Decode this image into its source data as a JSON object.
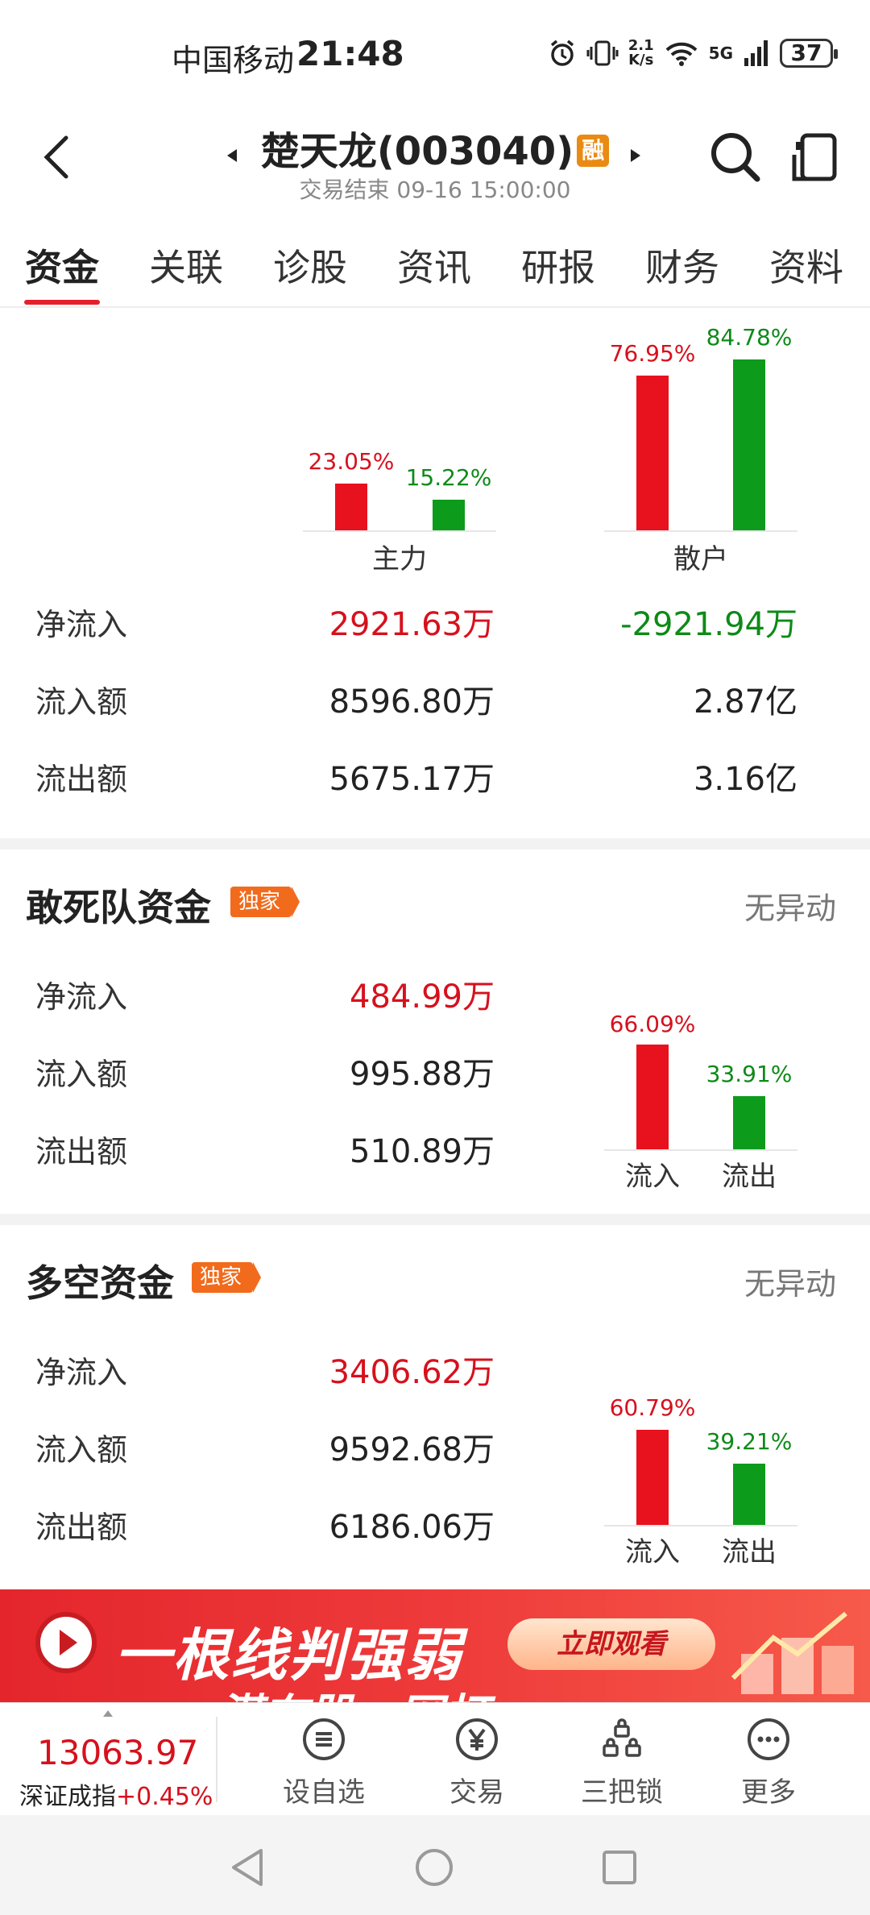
{
  "status_bar": {
    "carrier": "中国移动",
    "time": "21:48",
    "net_speed_value": "2.1",
    "net_speed_unit": "K/s",
    "network": "5G",
    "battery": "37"
  },
  "header": {
    "stock_name": "楚天龙(003040)",
    "margin_badge": "融",
    "trade_status": "交易结束 09-16 15:00:00"
  },
  "tabs": [
    "资金",
    "关联",
    "诊股",
    "资讯",
    "研报",
    "财务",
    "资料"
  ],
  "main_funds": {
    "chart_data": {
      "type": "bar",
      "categories": [
        "主力",
        "散户"
      ],
      "series": [
        {
          "name": "流入",
          "values": [
            23.05,
            76.95
          ],
          "labels": [
            "23.05%",
            "76.95%"
          ]
        },
        {
          "name": "流出",
          "values": [
            15.22,
            84.78
          ],
          "labels": [
            "15.22%",
            "84.78%"
          ]
        }
      ]
    },
    "rows": [
      {
        "label": "净流入",
        "main": "2921.63万",
        "retail": "-2921.94万"
      },
      {
        "label": "流入额",
        "main": "8596.80万",
        "retail": "2.87亿"
      },
      {
        "label": "流出额",
        "main": "5675.17万",
        "retail": "3.16亿"
      }
    ]
  },
  "dare_to_die": {
    "title": "敢死队资金",
    "badge": "独家",
    "status": "无异动",
    "rows": [
      {
        "label": "净流入",
        "value": "484.99万"
      },
      {
        "label": "流入额",
        "value": "995.88万"
      },
      {
        "label": "流出额",
        "value": "510.89万"
      }
    ],
    "chart_data": {
      "type": "bar",
      "categories": [
        "流入",
        "流出"
      ],
      "values": [
        66.09,
        33.91
      ],
      "labels": [
        "66.09%",
        "33.91%"
      ]
    }
  },
  "long_short": {
    "title": "多空资金",
    "badge": "独家",
    "status": "无异动",
    "rows": [
      {
        "label": "净流入",
        "value": "3406.62万"
      },
      {
        "label": "流入额",
        "value": "9592.68万"
      },
      {
        "label": "流出额",
        "value": "6186.06万"
      }
    ],
    "chart_data": {
      "type": "bar",
      "categories": [
        "流入",
        "流出"
      ],
      "values": [
        60.79,
        39.21
      ],
      "labels": [
        "60.79%",
        "39.21%"
      ]
    }
  },
  "banner": {
    "title": "一根线判强弱",
    "button": "立即观看",
    "subtitle": "潜在股一网打"
  },
  "bottom_bar": {
    "index_value": "13063.97",
    "index_name": "深证成指",
    "index_change": "+0.45%",
    "nav": [
      "设自选",
      "交易",
      "三把锁",
      "更多"
    ]
  },
  "colors": {
    "up": "#e8111e",
    "down": "#0d9b1b",
    "accent": "#e5202c",
    "badge": "#f26b1d"
  }
}
